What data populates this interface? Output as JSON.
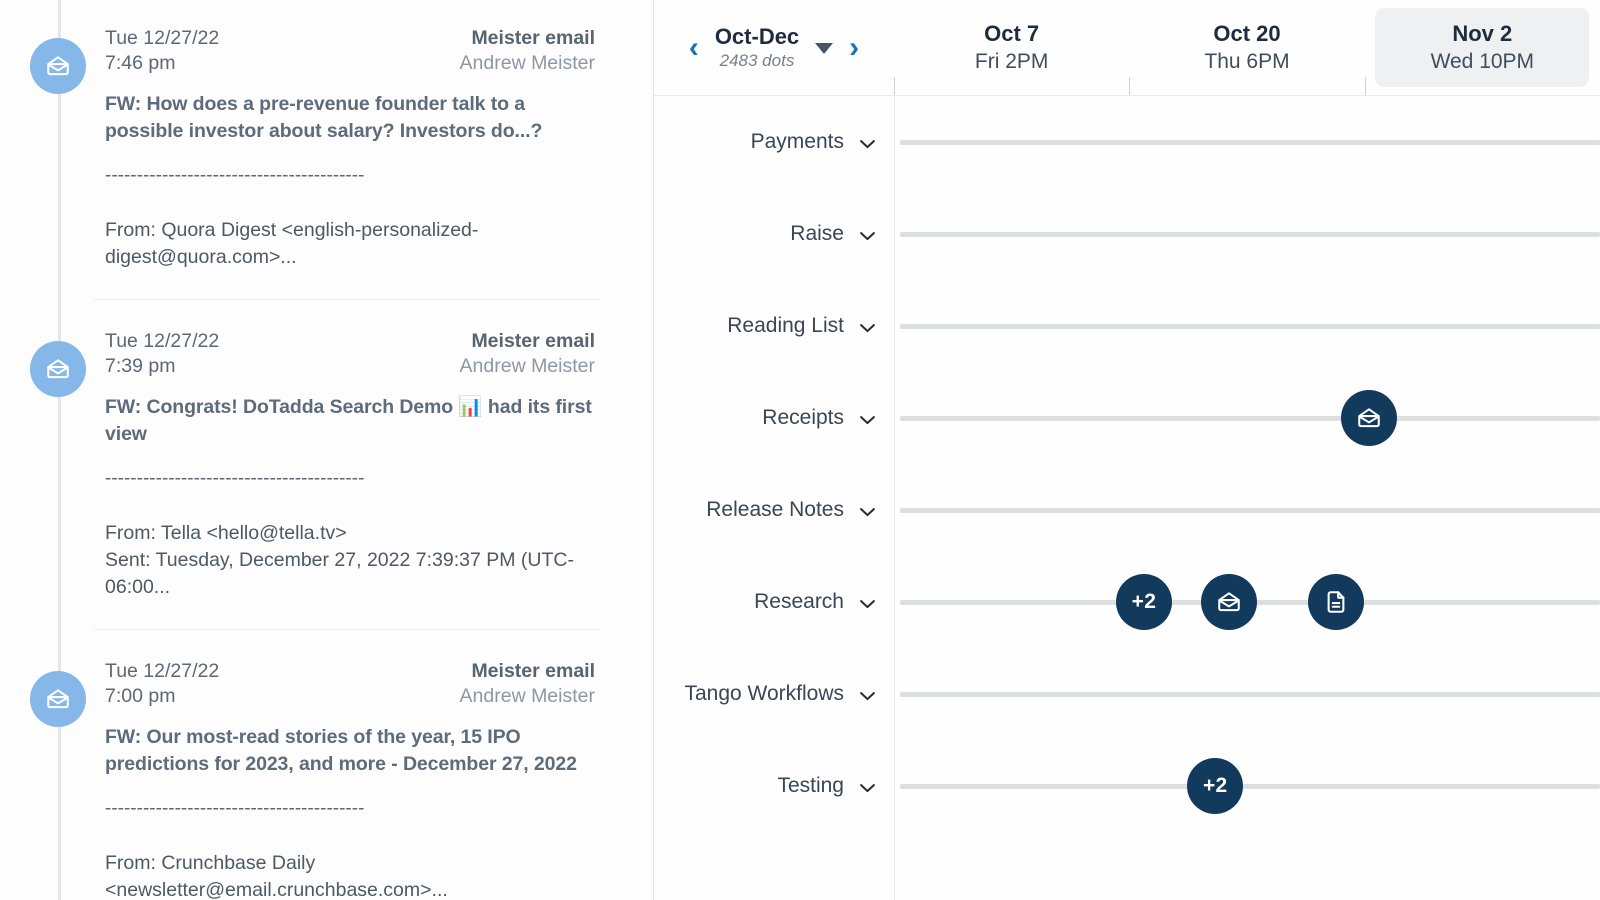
{
  "left_panel": {
    "emails": [
      {
        "date": "Tue 12/27/22",
        "time": "7:46 pm",
        "source": "Meister email",
        "person": "Andrew Meister",
        "subject": "FW: How does a pre-revenue founder talk to a possible investor about salary? Investors do...?",
        "emoji": "",
        "divider": "-----------------------------------------",
        "preview": "From: Quora Digest <english-personalized-digest@quora.com>...",
        "icon": "open-envelope-icon"
      },
      {
        "date": "Tue 12/27/22",
        "time": "7:39 pm",
        "source": "Meister email",
        "person": "Andrew Meister",
        "subject_before": "FW: Congrats! DoTadda Search Demo ",
        "emoji": "📊",
        "subject_after": " had its first view",
        "subject": "FW: Congrats! DoTadda Search Demo 📊 had its first view",
        "divider": "-----------------------------------------",
        "preview": "From: Tella <hello@tella.tv>\nSent: Tuesday, December 27, 2022 7:39:37 PM (UTC-06:00...",
        "icon": "open-envelope-icon"
      },
      {
        "date": "Tue 12/27/22",
        "time": "7:00 pm",
        "source": "Meister email",
        "person": "Andrew Meister",
        "subject": "FW: Our most-read stories of the year, 15 IPO predictions for 2023, and more - December 27, 2022",
        "emoji": "",
        "divider": "-----------------------------------------",
        "preview": "From: Crunchbase Daily <newsletter@email.crunchbase.com>...",
        "icon": "open-envelope-icon"
      }
    ]
  },
  "timeline": {
    "nav": {
      "prev_label": "‹",
      "next_label": "›",
      "range_title": "Oct-Dec",
      "range_subtitle": "2483 dots",
      "caret_icon": "caret-down-icon"
    },
    "columns": [
      {
        "date": "Oct 7",
        "time": "Fri 2PM",
        "active": false
      },
      {
        "date": "Oct 20",
        "time": "Thu 6PM",
        "active": false
      },
      {
        "date": "Nov 2",
        "time": "Wed 10PM",
        "active": true
      }
    ],
    "rows": [
      {
        "label": "Payments",
        "dots": []
      },
      {
        "label": "Raise",
        "dots": []
      },
      {
        "label": "Reading List",
        "dots": []
      },
      {
        "label": "Receipts",
        "dots": [
          {
            "type": "icon",
            "icon": "open-envelope-icon",
            "x_pct": 67.3
          }
        ]
      },
      {
        "label": "Release Notes",
        "dots": []
      },
      {
        "label": "Research",
        "dots": [
          {
            "type": "count",
            "text": "+2",
            "x_pct": 35.4
          },
          {
            "type": "icon",
            "icon": "open-envelope-icon",
            "x_pct": 47.5
          },
          {
            "type": "icon",
            "icon": "document-icon",
            "x_pct": 62.6
          }
        ]
      },
      {
        "label": "Tango Workflows",
        "dots": []
      },
      {
        "label": "Testing",
        "dots": [
          {
            "type": "count",
            "text": "+2",
            "x_pct": 45.5
          }
        ]
      }
    ]
  },
  "colors": {
    "accent_blue": "#1b72b5",
    "avatar_blue": "#85b8e8",
    "dot_navy": "#123a5c",
    "rail_gray": "#dcdee0",
    "active_pill": "#eef0f2"
  }
}
